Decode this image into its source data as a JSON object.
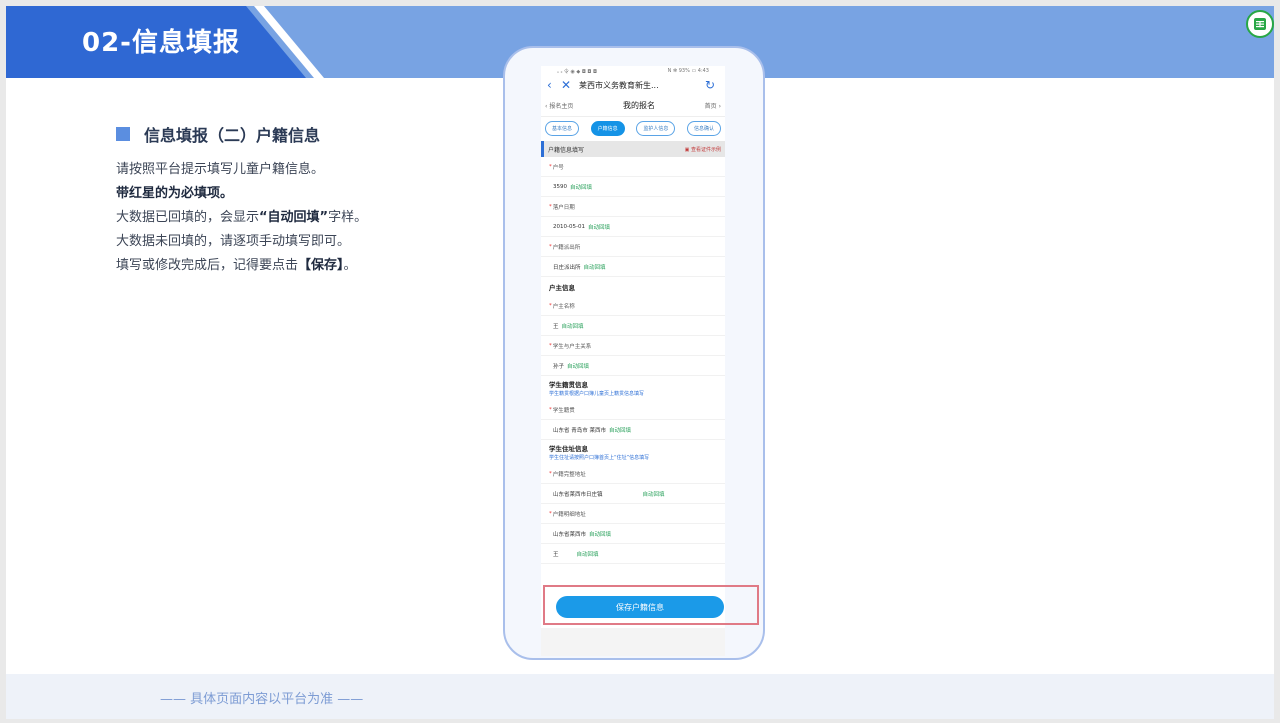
{
  "header": {
    "title": "02-信息填报"
  },
  "section": {
    "title": "信息填报（二）户籍信息",
    "line1": "请按照平台提示填写儿童户籍信息。",
    "line2": "带红星的为必填项。",
    "line3_pre": "大数据已回填的，会显示",
    "line3_bold": "“自动回填”",
    "line3_post": "字样。",
    "line4": "大数据未回填的，请逐项手动填写即可。",
    "line5_pre": "填写或修改完成后，记得要点击",
    "line5_bold": "【保存】",
    "line5_post": "。"
  },
  "footer": {
    "text": "—— 具体页面内容以平台为准 ——"
  },
  "phone": {
    "status_left": "ₙ ᵢₗ 令 ◉ ◆ ◘ ◘ ◘",
    "status_right": "N ✻ 93% ▭ 4:43",
    "app_title": "莱西市义务教育新生...",
    "back_label": "报名主页",
    "page_title": "我的报名",
    "home_label": "首页",
    "tabs": [
      "基本信息",
      "户籍信息",
      "监护人信息",
      "信息确认"
    ],
    "section_bar": "户籍信息填写",
    "example_link": "查看证件示例",
    "auto_fill": "自动回填",
    "fields": {
      "hukou_no_label": "户号",
      "hukou_no_value": "3590",
      "settle_date_label": "落户日期",
      "settle_date_value": "2010-05-01",
      "police_label": "户籍派出所",
      "police_value": "日庄派出所",
      "owner_group": "户主信息",
      "owner_name_label": "户主名称",
      "owner_name_value": "王",
      "relation_label": "学生与户主关系",
      "relation_value": "孙子",
      "native_group": "学生籍贯信息",
      "native_hint": "学生籍贯根据户口簿儿童页上籍贯信息填写",
      "native_label": "学生籍贯",
      "native_value": "山东省 青岛市 莱西市",
      "address_group": "学生住址信息",
      "address_hint": "学生住址请按照户口簿首页上“住址”信息填写",
      "full_address_label": "户籍完整地址",
      "full_address_value": "山东省莱西市日庄镇",
      "detail_address_label": "户籍明细地址",
      "detail_address_value": "山东省莱西市",
      "last_value": "王"
    },
    "save_button": "保存户籍信息"
  },
  "colors": {
    "header_dark": "#2f68d3",
    "header_light": "#78a3e3",
    "primary_button": "#1b9ae8",
    "auto_fill_green": "#27a05a",
    "highlight_border": "#e07a86"
  }
}
